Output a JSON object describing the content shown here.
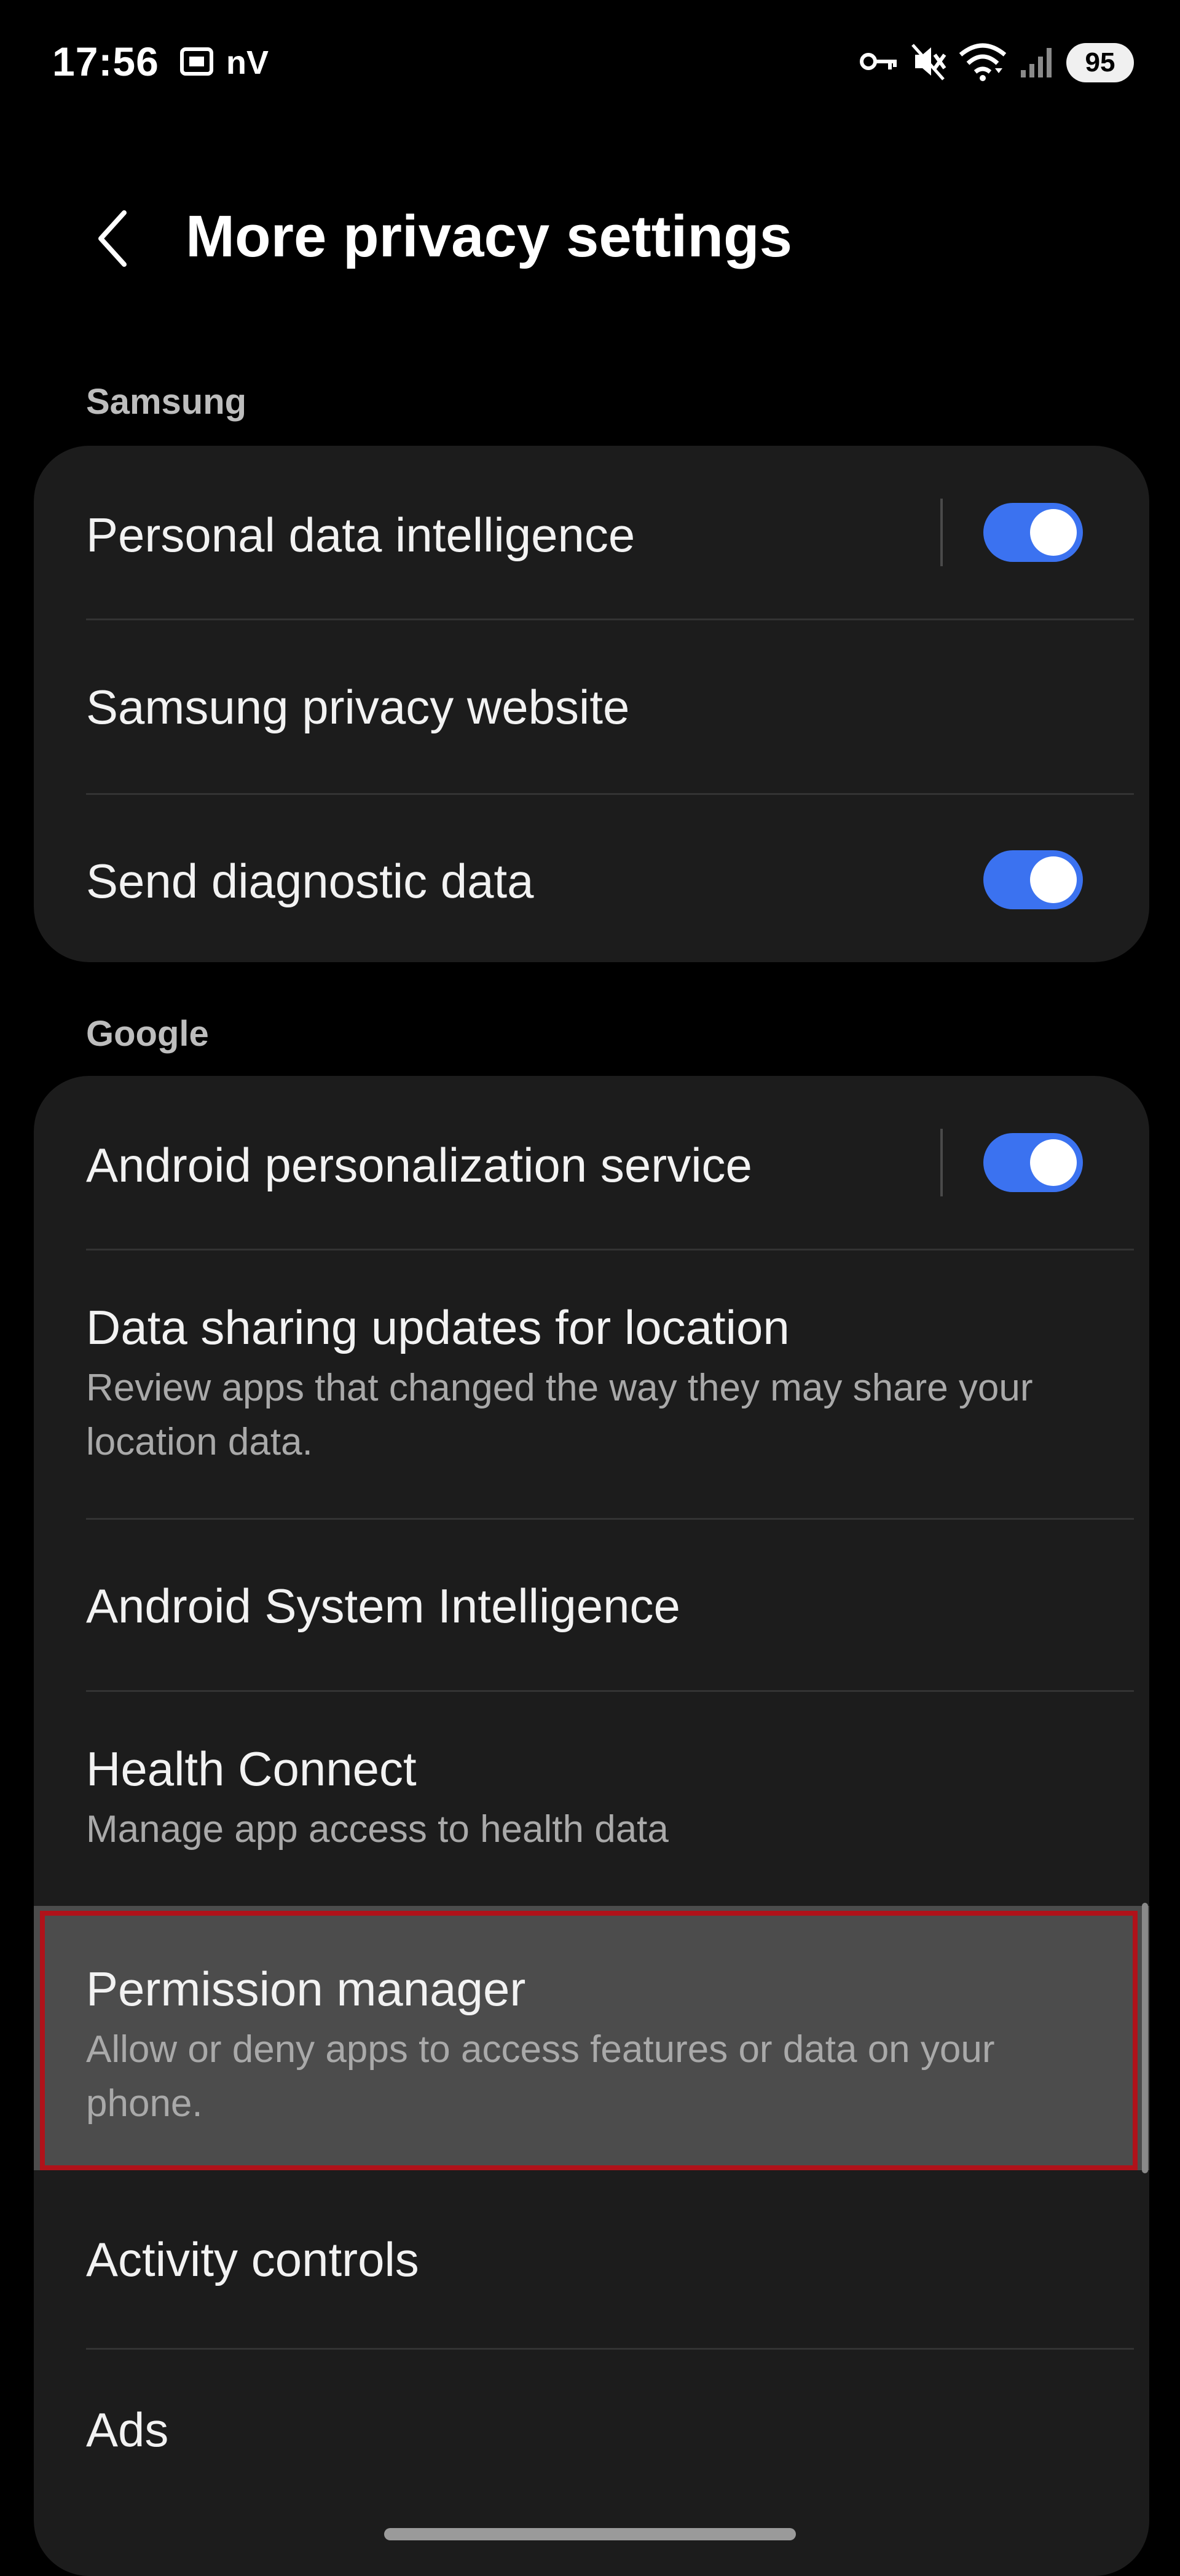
{
  "status_bar": {
    "time": "17:56",
    "left_icons": [
      "screenshot-icon",
      "nv-app-icon"
    ],
    "nv_label": "nV",
    "right_icons": [
      "vpn-key-icon",
      "vibrate-mute-icon",
      "wifi-icon",
      "signal-icon"
    ],
    "battery": "95"
  },
  "header": {
    "title": "More privacy settings",
    "back_icon": "chevron-left-icon"
  },
  "sections": {
    "samsung": {
      "label": "Samsung",
      "items": [
        {
          "title": "Personal data intelligence",
          "toggle": true
        },
        {
          "title": "Samsung privacy website"
        },
        {
          "title": "Send diagnostic data",
          "toggle": true
        }
      ]
    },
    "google": {
      "label": "Google",
      "items": [
        {
          "title": "Android personalization service",
          "toggle": true
        },
        {
          "title": "Data sharing updates for location",
          "subtitle": "Review apps that changed the way they may share your location data."
        },
        {
          "title": "Android System Intelligence"
        },
        {
          "title": "Health Connect",
          "subtitle": "Manage app access to health data"
        },
        {
          "title": "Permission manager",
          "subtitle": "Allow or deny apps to access features or data on your phone.",
          "highlighted": true
        },
        {
          "title": "Activity controls"
        },
        {
          "title": "Ads"
        }
      ]
    }
  },
  "colors": {
    "background": "#000000",
    "card": "#1c1c1c",
    "toggle_on": "#3b72f0",
    "highlight_fill": "#4c4c4c",
    "highlight_border": "#b0121a"
  }
}
